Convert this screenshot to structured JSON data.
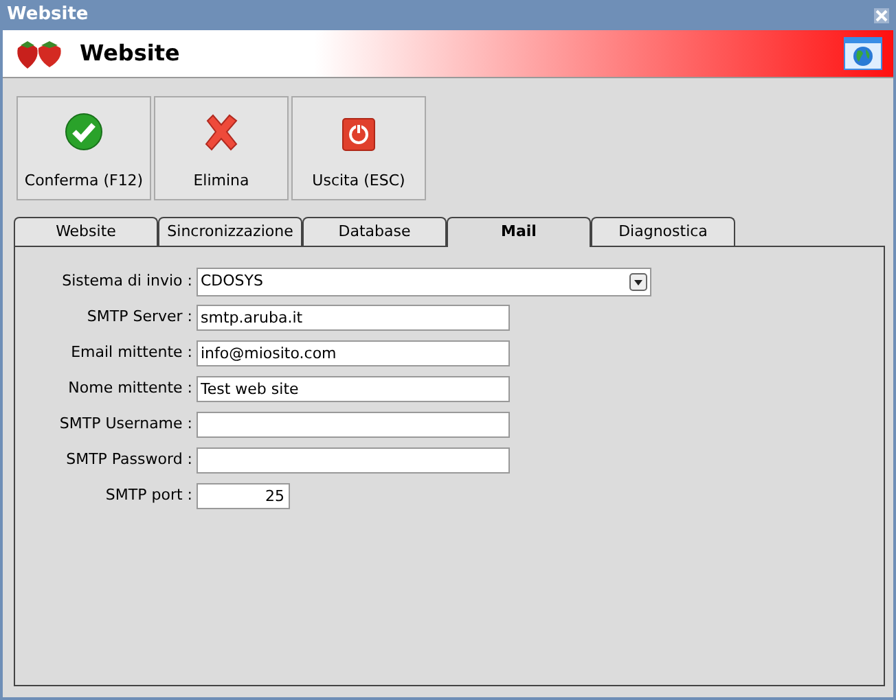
{
  "window": {
    "title": "Website"
  },
  "header": {
    "title": "Website"
  },
  "toolbar": [
    {
      "label": "Conferma (F12)",
      "kind": "confirm"
    },
    {
      "label": "Elimina",
      "kind": "delete"
    },
    {
      "label": "Uscita (ESC)",
      "kind": "exit"
    }
  ],
  "tabs": [
    {
      "label": "Website",
      "selected": false
    },
    {
      "label": "Sincronizzazione",
      "selected": false
    },
    {
      "label": "Database",
      "selected": false
    },
    {
      "label": "Mail",
      "selected": true
    },
    {
      "label": "Diagnostica",
      "selected": false
    }
  ],
  "fields": [
    {
      "label": "Sistema di invio :",
      "kind": "dropdown",
      "value": "CDOSYS"
    },
    {
      "label": "SMTP Server :",
      "kind": "text",
      "value": "smtp.aruba.it"
    },
    {
      "label": "Email mittente :",
      "kind": "text",
      "value": "info@miosito.com"
    },
    {
      "label": "Nome mittente :",
      "kind": "text",
      "value": "Test web site"
    },
    {
      "label": "SMTP Username :",
      "kind": "text"
    },
    {
      "label": "SMTP Password :",
      "kind": "text"
    },
    {
      "label": "SMTP port :",
      "kind": "number",
      "value": "25"
    }
  ]
}
